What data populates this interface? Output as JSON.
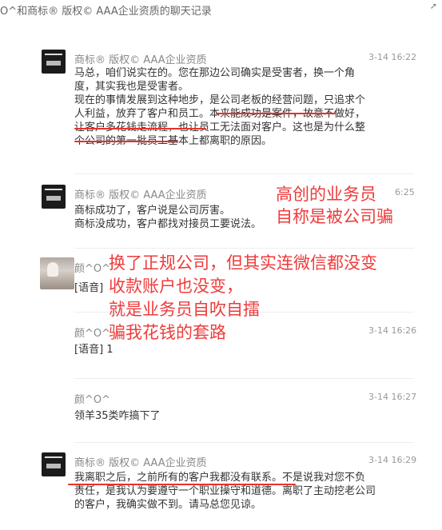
{
  "window": {
    "title": "O^和商标® 版权© AAA企业资质的聊天记录",
    "pin_icon": "pin-icon"
  },
  "messages": [
    {
      "sender": "商标® 版权© AAA企业资质",
      "time": "3-14 16:22",
      "avatar": "company-logo-avatar",
      "lines": [
        "马总，咱们说实在的。您在那边公司确实是受害者，换一个角",
        "度，其实我也是受害者。",
        "现在的事情发展到这种地步，是公司老板的经营问题，只追求个",
        "人利益，放弃了客户和员工。本来能成功是案件，故意不做好，",
        "让客户多花钱走流程，也让员工无法面对客户。这也是为什么整",
        "个公司的第一批员工基本上都离职的原因。"
      ]
    },
    {
      "sender": "商标® 版权© AAA企业资质",
      "time": "6:25",
      "avatar": "company-logo-avatar",
      "lines": [
        "商标成功了，客户说是公司厉害。",
        "商标没成功，客户都找对接员工要说法。"
      ]
    },
    {
      "sender": "颜^O^",
      "time": "",
      "avatar": "user-photo-avatar",
      "lines": [
        "[语音]"
      ]
    },
    {
      "sender": "颜^O^",
      "time": "3-14 16:26",
      "avatar": "",
      "lines": [
        "[语音] 1"
      ]
    },
    {
      "sender": "颜^O^",
      "time": "3-14 16:27",
      "avatar": "",
      "lines": [
        "领羊35类咋搞下了"
      ]
    },
    {
      "sender": "商标® 版权© AAA企业资质",
      "time": "3-14 16:29",
      "avatar": "company-logo-avatar",
      "lines": [
        "我离职之后，之前所有的客户我都没有联系。不是说我对您不负",
        "责任，是我认为要遵守一个职业操守和道德。离职了主动挖老公司",
        "的客户，我确实做不到。请马总您见谅。"
      ]
    }
  ],
  "annotations": {
    "note1": [
      "高创的业务员",
      "自称是被公司骗"
    ],
    "note2": [
      "换了正规公司，但其实连微信都没变",
      "收款账户也没变，",
      "就是业务员自吹自擂",
      "骗我花钱的套路"
    ]
  },
  "colors": {
    "annotation": "#ee3b3b",
    "underline": "#e5332a"
  }
}
